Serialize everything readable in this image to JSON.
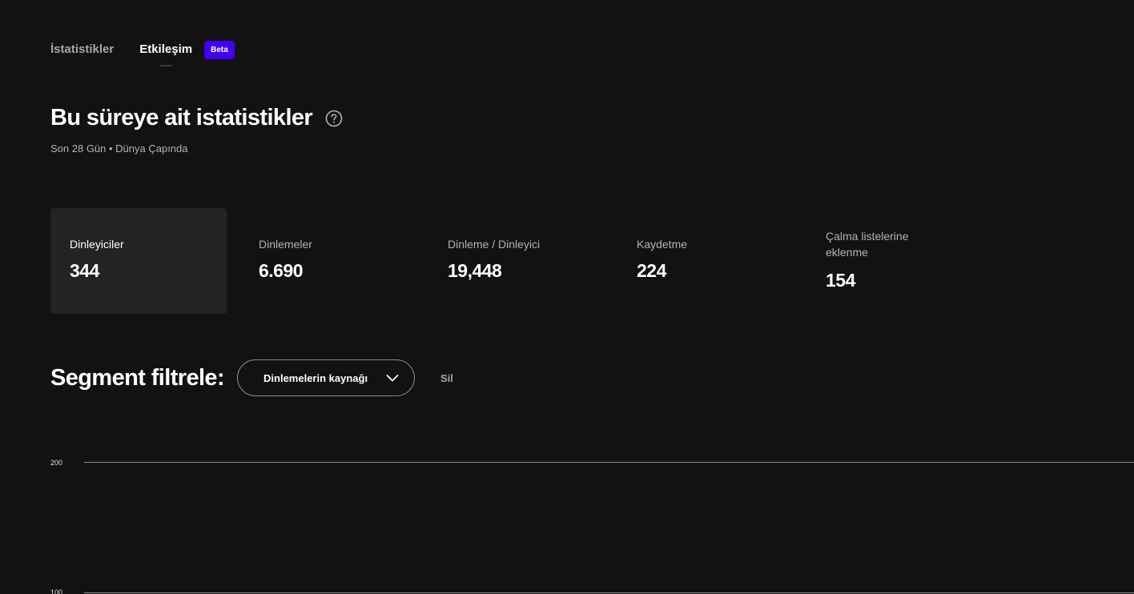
{
  "tabs": [
    {
      "label": "İstatistikler",
      "active": false
    },
    {
      "label": "Etkileşim",
      "active": true,
      "badge": "Beta"
    }
  ],
  "header": {
    "title": "Bu süreye ait istatistikler",
    "help_icon": "question-circle-icon",
    "subtitle": "Son 28 Gün • Dünya Çapında"
  },
  "metrics": [
    {
      "label": "Dinleyiciler",
      "value": "344",
      "selected": true
    },
    {
      "label": "Dinlemeler",
      "value": "6.690"
    },
    {
      "label": "Dinleme / Dinleyici",
      "value": "19,448"
    },
    {
      "label": "Kaydetme",
      "value": "224"
    },
    {
      "label": "Çalma listelerine eklenme",
      "value": "154"
    }
  ],
  "segment": {
    "title": "Segment filtrele:",
    "dropdown_value": "Dinlemelerin kaynağı",
    "dropdown_icon": "chevron-down-icon",
    "clear_label": "Sil"
  },
  "chart": {
    "y_ticks": [
      "200",
      "100"
    ]
  },
  "colors": {
    "background": "#121212",
    "selected_card": "#232323",
    "beta_badge": "#4100f4"
  }
}
